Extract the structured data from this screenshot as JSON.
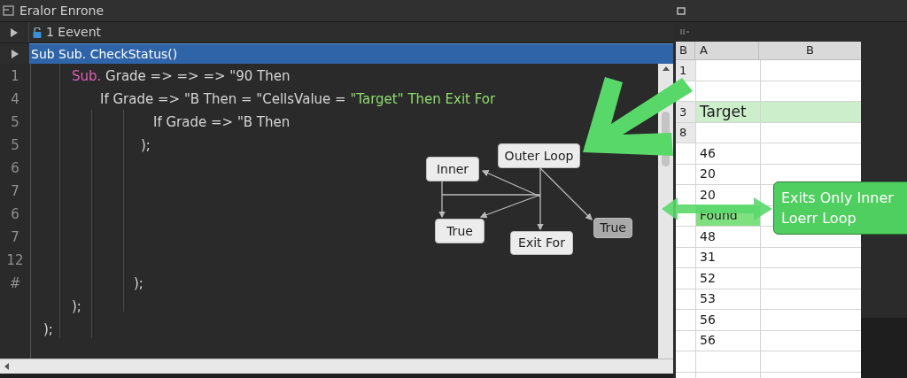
{
  "window": {
    "title": "Eralor Enrone"
  },
  "event_row": {
    "label": "1 Eevent"
  },
  "selected_line": {
    "text": "Sub Sub. CheckStatus()"
  },
  "code_lines": [
    {
      "number": "1",
      "segments": [
        {
          "text": "Sub.",
          "kind": "keyword"
        },
        {
          "text": " Grade => => => \"90 Then",
          "kind": "plain"
        }
      ]
    },
    {
      "number": "4",
      "segments": [
        {
          "text": "If Grade => \"B Then = \"CellsValue = ",
          "kind": "plain"
        },
        {
          "text": "\"Target\" Then Exit For",
          "kind": "string"
        }
      ]
    },
    {
      "number": "5",
      "segments": [
        {
          "text": "If Grade => \"B Then",
          "kind": "plain"
        }
      ]
    },
    {
      "number": "5",
      "segments": [
        {
          "text": ");",
          "kind": "plain"
        }
      ]
    },
    {
      "number": "6"
    },
    {
      "number": "7"
    },
    {
      "number": "6"
    },
    {
      "number": "7"
    },
    {
      "number": "12"
    },
    {
      "number": "#",
      "segments": [
        {
          "text": ");",
          "kind": "plain"
        }
      ]
    },
    {
      "segments": [
        {
          "text": ");",
          "kind": "plain"
        }
      ]
    },
    {
      "segments": [
        {
          "text": ");",
          "kind": "plain"
        }
      ]
    }
  ],
  "diagram": {
    "nodes": [
      {
        "label": "Outer Loop",
        "kind": "normal"
      },
      {
        "label": "Inner",
        "kind": "normal"
      },
      {
        "label": "True",
        "kind": "normal"
      },
      {
        "label": "Exit For",
        "kind": "normal"
      },
      {
        "label": "True",
        "kind": "muted"
      }
    ]
  },
  "sheet": {
    "columns": [
      "B",
      "A",
      "B"
    ],
    "rows": [
      {
        "label": "1",
        "row_highlighted": false,
        "cell_highlighted": false
      },
      {
        "row_highlighted": false,
        "cell_highlighted": false
      },
      {
        "label": "3",
        "value": "Target",
        "row_highlighted": true,
        "cell_highlighted": false
      },
      {
        "label": "8",
        "row_highlighted": false,
        "cell_highlighted": false
      },
      {
        "value": "46",
        "row_highlighted": false,
        "cell_highlighted": false
      },
      {
        "value": "20",
        "row_highlighted": false,
        "cell_highlighted": false
      },
      {
        "value": "20",
        "row_highlighted": false,
        "cell_highlighted": false
      },
      {
        "value": "Found",
        "row_highlighted": false,
        "cell_highlighted": true
      },
      {
        "value": "48",
        "row_highlighted": false,
        "cell_highlighted": false
      },
      {
        "value": "31",
        "row_highlighted": false,
        "cell_highlighted": false
      },
      {
        "value": "52",
        "row_highlighted": false,
        "cell_highlighted": false
      },
      {
        "value": "53",
        "row_highlighted": false,
        "cell_highlighted": false
      },
      {
        "value": "56",
        "row_highlighted": false,
        "cell_highlighted": false
      },
      {
        "value": "56",
        "row_highlighted": false,
        "cell_highlighted": false
      },
      {
        "row_highlighted": false,
        "cell_highlighted": false
      }
    ]
  },
  "callout": {
    "lines": [
      "Exits Only Inner",
      "Loerr Loop"
    ]
  }
}
